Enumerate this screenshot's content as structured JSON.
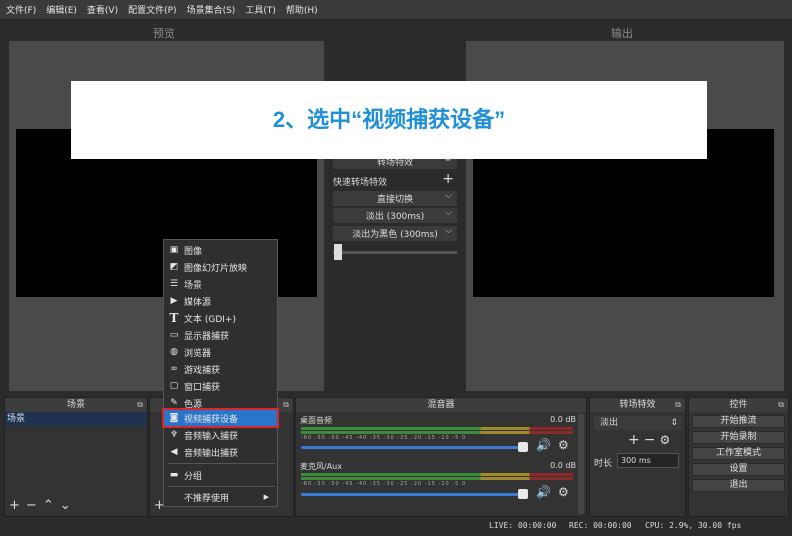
{
  "menu": [
    "文件(F)",
    "编辑(E)",
    "查看(V)",
    "配置文件(P)",
    "场景集合(S)",
    "工具(T)",
    "帮助(H)"
  ],
  "preview_title": "预览",
  "output_title": "输出",
  "banner": "2、选中“视频捕获设备”",
  "transitions": {
    "top_partial": "转场特效",
    "quick": "快速转场特效",
    "items": [
      "直接切换",
      "淡出 (300ms)",
      "淡出为黑色 (300ms)"
    ]
  },
  "context_menu": {
    "items": [
      {
        "icon": "image-icon",
        "label": "图像"
      },
      {
        "icon": "slideshow-icon",
        "label": "图像幻灯片放映"
      },
      {
        "icon": "list-icon",
        "label": "场景"
      },
      {
        "icon": "play-icon",
        "label": "媒体源"
      },
      {
        "icon": "text-icon",
        "label": "文本 (GDI+)"
      },
      {
        "icon": "monitor-icon",
        "label": "显示器捕获"
      },
      {
        "icon": "globe-icon",
        "label": "浏览器"
      },
      {
        "icon": "gamepad-icon",
        "label": "游戏捕获"
      },
      {
        "icon": "window-icon",
        "label": "窗口捕获"
      },
      {
        "icon": "brush-icon",
        "label": "色源"
      },
      {
        "icon": "camera-icon",
        "label": "视频捕获设备"
      },
      {
        "icon": "mic-icon",
        "label": "音频输入捕获"
      },
      {
        "icon": "speaker-icon",
        "label": "音频输出捕获"
      },
      {
        "icon": "folder-icon",
        "label": "分组"
      },
      {
        "icon": "",
        "label": "不推荐使用"
      }
    ],
    "selected": "视频捕获设备"
  },
  "docks": {
    "scenes": {
      "title": "场景",
      "items": [
        "场景"
      ]
    },
    "mixer": {
      "title": "混音器",
      "tracks": [
        {
          "name": "桌面音频",
          "db": "0.0 dB"
        },
        {
          "name": "麦克风/Aux",
          "db": "0.0 dB"
        }
      ],
      "ticks": "-60 -55 -50 -45 -40 -35 -30 -25 -20 -15 -10 -5 0"
    },
    "transitions": {
      "title": "转场特效",
      "select": "淡出",
      "duration_label": "时长",
      "duration": "300 ms"
    },
    "controls": {
      "title": "控件",
      "buttons": [
        "开始推流",
        "开始录制",
        "工作室模式",
        "设置",
        "退出"
      ]
    }
  },
  "status": {
    "live": "LIVE: 00:00:00",
    "rec": "REC: 00:00:00",
    "cpu": "CPU: 2.9%, 30.00 fps"
  },
  "colors": {
    "accent": "#1f8fd6",
    "highlight": "#2a74c9",
    "red_frame": "#d9262b"
  }
}
